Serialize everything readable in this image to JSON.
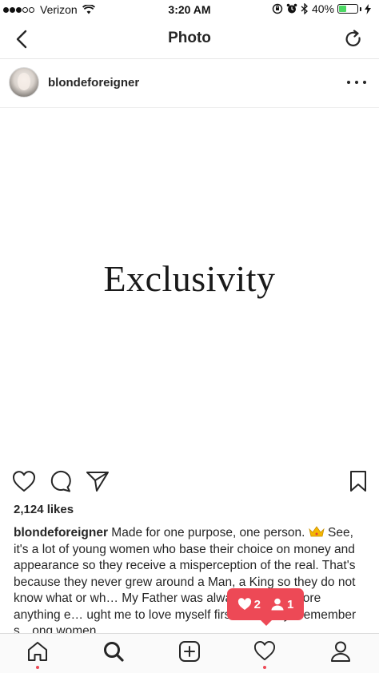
{
  "status_bar": {
    "carrier": "Verizon",
    "time": "3:20 AM",
    "battery_percent": "40%",
    "battery_level": 0.4,
    "signal_bars_filled": 3,
    "signal_bars_total": 5
  },
  "nav": {
    "title": "Photo",
    "back_icon": "chevron-left-icon",
    "refresh_icon": "refresh-icon"
  },
  "post": {
    "username": "blondeforeigner",
    "photo_text": "Exclusivity",
    "likes": "2,124 likes",
    "caption_user": "blondeforeigner",
    "caption_text": " Made for one purpose, one person. ",
    "caption_text_2": " See, it's a lot of young women who base their choice on money and appearance so they receive a misperception of the real. That's because they never grew around a Man, a King so they do not know what or wh… My Father was always a Man before anything e… ught me to love myself first but always remember s…ong women"
  },
  "activity_toast": {
    "likes": "2",
    "follows": "1"
  },
  "colors": {
    "accent_red": "#ed4956",
    "text": "#262626",
    "battery_green": "#4cd964"
  }
}
